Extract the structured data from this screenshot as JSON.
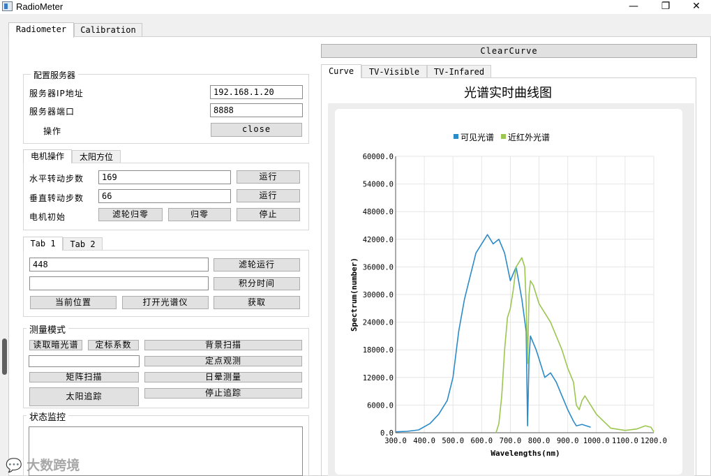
{
  "window": {
    "title": "RadioMeter",
    "minimize": "—",
    "maximize": "❐",
    "close": "✕"
  },
  "main_tabs": [
    "Radiometer",
    "Calibration"
  ],
  "server": {
    "group_title": "配置服务器",
    "ip_label": "服务器IP地址",
    "ip_value": "192.168.1.20",
    "port_label": "服务器端口",
    "port_value": "8888",
    "op_label": "操作",
    "close_button": "close"
  },
  "motor": {
    "tabs": [
      "电机操作",
      "太阳方位"
    ],
    "h_label": "水平转动步数",
    "h_value": "169",
    "v_label": "垂直转动步数",
    "v_value": "66",
    "run1": "运行",
    "run2": "运行",
    "init_label": "电机初始",
    "filter_zero": "滤轮归零",
    "zero": "归零",
    "stop": "停止"
  },
  "tab1": {
    "tabs": [
      "Tab 1",
      "Tab 2"
    ],
    "value1": "448",
    "value2": "",
    "filter_run": "滤轮运行",
    "integration_time": "积分时间",
    "current_pos": "当前位置",
    "open_spectrometer": "打开光谱仪",
    "acquire": "获取"
  },
  "measure": {
    "group_title": "测量模式",
    "read_dark": "读取暗光谱",
    "calib_coef": "定标系数",
    "bg_scan": "背景扫描",
    "input_value": "",
    "fixed_obs": "定点观测",
    "matrix_scan": "矩阵扫描",
    "halo_measure": "日晕测量",
    "sun_track": "太阳追踪",
    "stop_track": "停止追踪"
  },
  "status": {
    "group_title": "状态监控"
  },
  "right": {
    "clear_curve": "ClearCurve",
    "tabs": [
      "Curve",
      "TV-Visible",
      "TV-Infared"
    ]
  },
  "colors": {
    "visible": "#2a8bc8",
    "nir": "#9bc64f",
    "grid": "#e6e6e6"
  },
  "chart_data": {
    "type": "line",
    "title": "光谱实时曲线图",
    "xlabel": "Wavelengths(nm)",
    "ylabel": "Spectrum(number)",
    "xlim": [
      300,
      1200
    ],
    "ylim": [
      0,
      60000
    ],
    "xticks": [
      "300.0",
      "400.0",
      "500.0",
      "600.0",
      "700.0",
      "800.0",
      "900.0",
      "1000.0",
      "1100.0",
      "1200.0"
    ],
    "yticks": [
      "0.0",
      "6000.0",
      "12000.0",
      "18000.0",
      "24000.0",
      "30000.0",
      "36000.0",
      "42000.0",
      "48000.0",
      "54000.0",
      "60000.0"
    ],
    "legend_position": "top",
    "grid": true,
    "series": [
      {
        "name": "可见光谱",
        "x": [
          300,
          340,
          380,
          420,
          450,
          480,
          500,
          520,
          540,
          560,
          580,
          600,
          620,
          640,
          660,
          680,
          700,
          720,
          740,
          755,
          760,
          765,
          770,
          790,
          800,
          820,
          840,
          860,
          880,
          900,
          920,
          930,
          950,
          980
        ],
        "y": [
          200,
          300,
          600,
          2000,
          4000,
          7000,
          12000,
          22000,
          29000,
          34000,
          39000,
          41000,
          43000,
          41000,
          42000,
          39000,
          33000,
          36000,
          29000,
          22000,
          1500,
          16000,
          21000,
          18000,
          16000,
          12000,
          13000,
          11000,
          8000,
          5000,
          2500,
          1500,
          1800,
          1200
        ]
      },
      {
        "name": "近红外光谱",
        "x": [
          650,
          660,
          670,
          680,
          690,
          700,
          710,
          720,
          730,
          740,
          750,
          755,
          760,
          765,
          770,
          780,
          800,
          820,
          840,
          860,
          880,
          900,
          920,
          930,
          940,
          950,
          960,
          970,
          1000,
          1050,
          1100,
          1140,
          1170,
          1190,
          1200
        ],
        "y": [
          0,
          2000,
          8000,
          18000,
          25000,
          27000,
          31000,
          36000,
          37000,
          38000,
          36000,
          28000,
          15000,
          30000,
          33000,
          32000,
          28000,
          26000,
          24000,
          21000,
          18000,
          14000,
          11000,
          6000,
          5000,
          7000,
          8000,
          7000,
          4000,
          1000,
          500,
          800,
          1500,
          1200,
          200
        ]
      }
    ]
  }
}
